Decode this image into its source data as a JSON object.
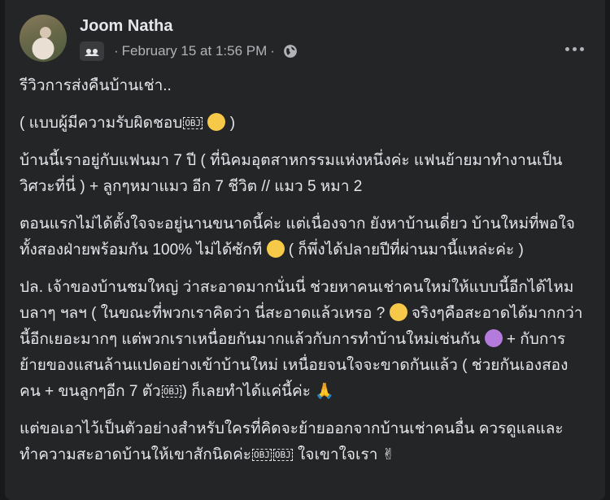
{
  "post": {
    "author": "Joom Natha",
    "timestamp": "February 15 at 1:56 PM",
    "separator": "·",
    "paragraphs": [
      "รีวิวการส่งคืนบ้านเช่า..",
      "( แบบผู้มีความรับผิดชอบ",
      "บ้านนี้เราอยู่กับแฟนมา 7 ปี ( ที่นิคมอุตสาหกรรมแห่งหนึ่งค่ะ แฟนย้ายมาทำงานเป็นวิศวะที่นี่ ) + ลูกๆหมาแมว อีก 7 ชีวิต // แมว 5 หมา 2",
      "ตอนแรกไม่ได้ตั้งใจจะอยู่นานขนาดนี้ค่ะ แต่เนื่องจาก ยังหาบ้านเดี่ยว บ้านใหม่ที่พอใจทั้งสองฝ่ายพร้อมกัน 100% ไม่ได้ซักที",
      "ปล. เจ้าของบ้านชมใหญ่ ว่าสะอาดมากนั่นนี่ ช่วยหาคนเช่าคนใหม่ให้แบบนี้อีกได้ไหม บลาๆ ฯลฯ ( ในขณะที่พวกเราคิดว่า นี่สะอาดแล้วเหรอ ?",
      "แต่ขอเอาไว้เป็นตัวอย่างสำหรับใครที่คิดจะย้ายออกจากบ้านเช่าคนอื่น ควรดูแลและทำความสะอาดบ้านให้เขาสักนิดค่ะ"
    ],
    "p2_tail": ")",
    "p4_tail": "( ก็พึ่งได้ปลายปีที่ผ่านมานี้แหล่ะค่ะ )",
    "p5_mid": "จริงๆคือสะอาดได้มากกว่านี้อีกเยอะมากๆ แต่พวกเราเหนื่อยกันมากแล้วกับการทำบ้านใหม่เช่นกัน",
    "p5_mid2": "+ กับการย้ายของแสนล้านแปดอย่างเข้าบ้านใหม่ เหนื่อยจนใจจะขาดกันแล้ว ( ช่วยกันเองสองคน + ขนลูกๆอีก 7 ตัว",
    "p5_tail": ") ก็เลยทำได้แค่นี้ค่ะ",
    "p6_tail": "ใจเขาใจเรา",
    "obj_marker": "OBJ"
  },
  "icons": {
    "avatar": "profile-photo",
    "group": "group-icon",
    "privacy": "globe-icon",
    "more": "more-options-icon"
  },
  "colors": {
    "background": "#18191a",
    "card": "#242526",
    "text_primary": "#e4e6eb",
    "text_secondary": "#b0b3b8"
  }
}
